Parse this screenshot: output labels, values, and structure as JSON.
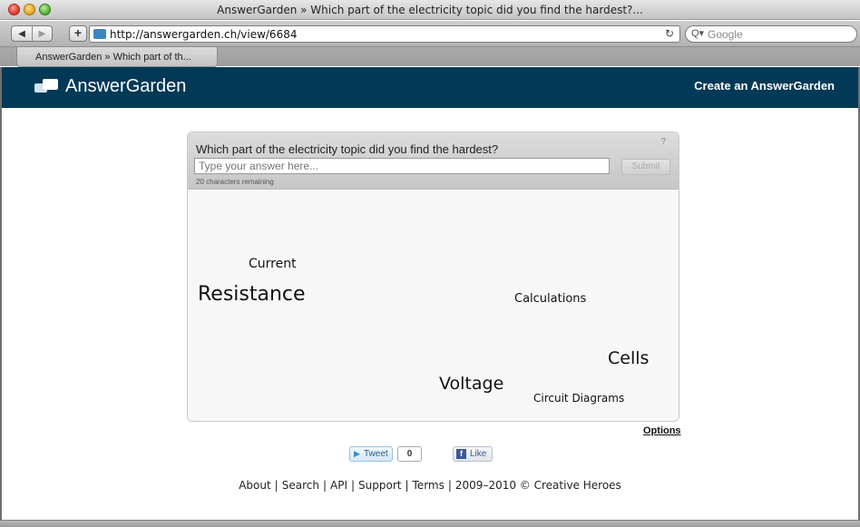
{
  "window": {
    "title": "AnswerGarden » Which part of the electricity topic did you find the hardest?...",
    "url": "http://answergarden.ch/view/6684",
    "search_placeholder": "Google",
    "tab_label": "AnswerGarden » Which part of th..."
  },
  "icons": {
    "back": "back-arrow-icon",
    "forward": "forward-arrow-icon",
    "add_bookmark": "plus-icon",
    "reload": "reload-icon",
    "search": "search-icon"
  },
  "header": {
    "logo_text": "AnswerGarden",
    "create_link": "Create an AnswerGarden",
    "bg_color": "#023956"
  },
  "garden": {
    "question": "Which part of the electricity topic did you find the hardest?",
    "help": "?",
    "input_placeholder": "Type your answer here...",
    "submit_label": "Submit",
    "remaining": "20 characters remaining",
    "answers": {
      "current": "Current",
      "resistance": "Resistance",
      "calculations": "Calculations",
      "cells": "Cells",
      "voltage": "Voltage",
      "circuit_diagrams": "Circuit Diagrams"
    },
    "options_link": "Options"
  },
  "social": {
    "tweet_label": "Tweet",
    "tweet_count": "0",
    "like_label": "Like"
  },
  "footer": {
    "about": "About",
    "search": "Search",
    "api": "API",
    "support": "Support",
    "terms": "Terms",
    "copyright": "2009–2010 © Creative Heroes"
  }
}
